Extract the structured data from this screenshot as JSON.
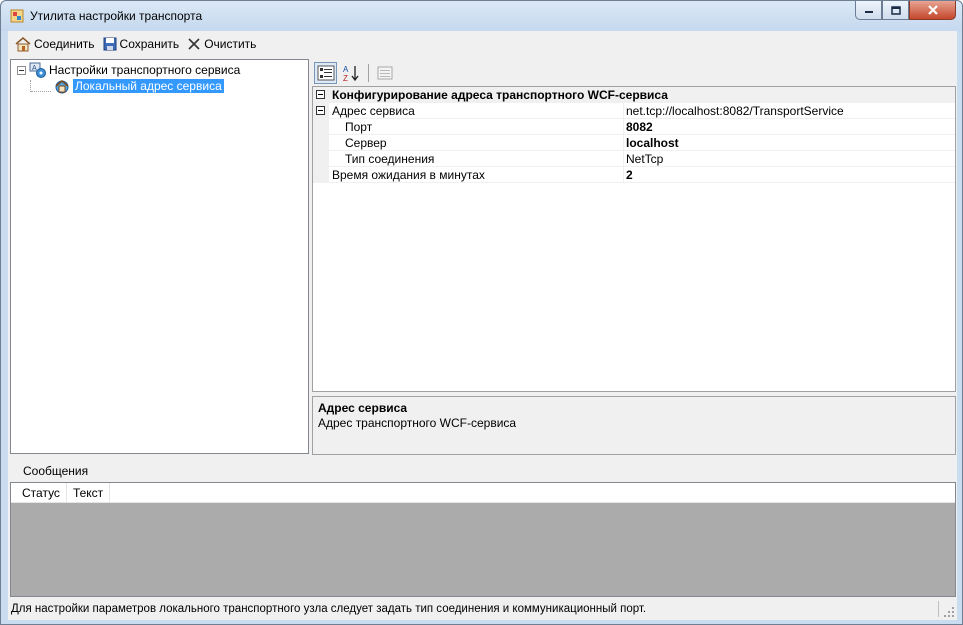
{
  "window": {
    "title": "Утилита настройки транспорта"
  },
  "toolbar": {
    "connect_label": "Соединить",
    "save_label": "Сохранить",
    "clear_label": "Очистить"
  },
  "tree": {
    "root_label": "Настройки транспортного сервиса",
    "child_label": "Локальный адрес сервиса"
  },
  "property_grid": {
    "category": "Конфигурирование адреса транспортного WCF-сервиса",
    "rows": [
      {
        "name": "Адрес сервиса",
        "value": "net.tcp://localhost:8082/TransportService"
      },
      {
        "name": "Порт",
        "value": "8082"
      },
      {
        "name": "Сервер",
        "value": "localhost"
      },
      {
        "name": "Тип соединения",
        "value": "NetTcp"
      },
      {
        "name": "Время ожидания в минутах",
        "value": "2"
      }
    ],
    "help_title": "Адрес сервиса",
    "help_description": "Адрес транспортного WCF-сервиса"
  },
  "messages": {
    "label": "Сообщения",
    "columns": [
      "Статус",
      "Текст"
    ]
  },
  "statusbar": {
    "text": "Для настройки параметров локального транспортного узла следует задать тип соединения и коммуникационный порт."
  },
  "colors": {
    "selection": "#3399ff",
    "frame": "#c9dcf0",
    "close_button": "#c4472b"
  }
}
